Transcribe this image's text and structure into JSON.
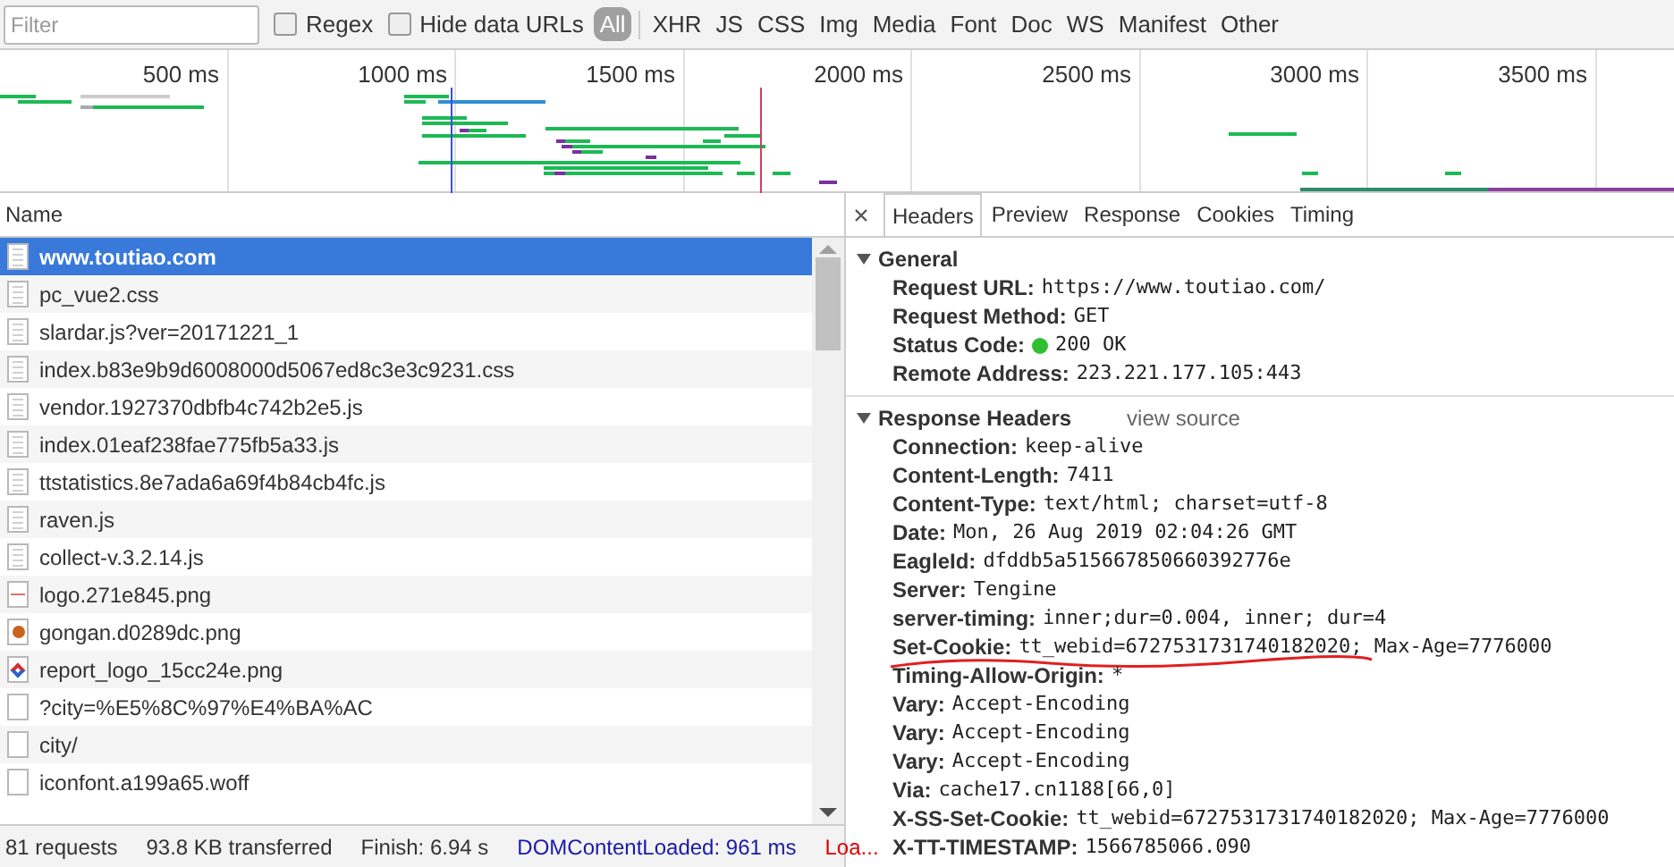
{
  "toolbar": {
    "filter": {
      "placeholder": "Filter"
    },
    "checkboxes": [
      {
        "label": "Regex",
        "checked": false
      },
      {
        "label": "Hide data URLs",
        "checked": false
      }
    ],
    "types": [
      {
        "label": "All",
        "selected": true
      },
      {
        "label": "XHR",
        "selected": false
      },
      {
        "label": "JS",
        "selected": false
      },
      {
        "label": "CSS",
        "selected": false
      },
      {
        "label": "Img",
        "selected": false
      },
      {
        "label": "Media",
        "selected": false
      },
      {
        "label": "Font",
        "selected": false
      },
      {
        "label": "Doc",
        "selected": false
      },
      {
        "label": "WS",
        "selected": false
      },
      {
        "label": "Manifest",
        "selected": false
      },
      {
        "label": "Other",
        "selected": false
      }
    ]
  },
  "overview": {
    "ticks": [
      "500 ms",
      "1000 ms",
      "1500 ms",
      "2000 ms",
      "2500 ms",
      "3000 ms",
      "3500 ms"
    ]
  },
  "requests": {
    "column": "Name",
    "rows": [
      {
        "name": "www.toutiao.com",
        "kind": "document",
        "selected": true
      },
      {
        "name": "pc_vue2.css",
        "kind": "document",
        "selected": false
      },
      {
        "name": "slardar.js?ver=20171221_1",
        "kind": "document",
        "selected": false
      },
      {
        "name": "index.b83e9b9d6008000d5067ed8c3e3c9231.css",
        "kind": "document",
        "selected": false
      },
      {
        "name": "vendor.1927370dbfb4c742b2e5.js",
        "kind": "document",
        "selected": false
      },
      {
        "name": "index.01eaf238fae775fb5a33.js",
        "kind": "document",
        "selected": false
      },
      {
        "name": "ttstatistics.8e7ada6a69f4b84cb4fc.js",
        "kind": "document",
        "selected": false
      },
      {
        "name": "raven.js",
        "kind": "document",
        "selected": false
      },
      {
        "name": "collect-v.3.2.14.js",
        "kind": "document",
        "selected": false
      },
      {
        "name": "logo.271e845.png",
        "kind": "line",
        "selected": false
      },
      {
        "name": "gongan.d0289dc.png",
        "kind": "dot",
        "selected": false
      },
      {
        "name": "report_logo_15cc24e.png",
        "kind": "diamond",
        "selected": false
      },
      {
        "name": "?city=%E5%8C%97%E4%BA%AC",
        "kind": "blank",
        "selected": false
      },
      {
        "name": "city/",
        "kind": "blank",
        "selected": false
      },
      {
        "name": "iconfont.a199a65.woff",
        "kind": "blank",
        "selected": false
      }
    ]
  },
  "status_bar": [
    {
      "text": "81 requests",
      "kind": "plain"
    },
    {
      "text": "93.8 KB transferred",
      "kind": "plain"
    },
    {
      "text": "Finish: 6.94 s",
      "kind": "plain"
    },
    {
      "text": "DOMContentLoaded: 961 ms",
      "kind": "blue"
    },
    {
      "text": "Loa...",
      "kind": "red"
    }
  ],
  "details": {
    "tabs": [
      {
        "label": "Headers",
        "selected": true
      },
      {
        "label": "Preview",
        "selected": false
      },
      {
        "label": "Response",
        "selected": false
      },
      {
        "label": "Cookies",
        "selected": false
      },
      {
        "label": "Timing",
        "selected": false
      }
    ],
    "sections": [
      {
        "title": "General",
        "expanded": true,
        "rows": [
          {
            "key": "Request URL:",
            "value": "https://www.toutiao.com/"
          },
          {
            "key": "Request Method:",
            "value": "GET"
          },
          {
            "key": "Status Code:",
            "value": "200 OK",
            "status_dot": true
          },
          {
            "key": "Remote Address:",
            "value": "223.221.177.105:443"
          }
        ]
      },
      {
        "title": "Response Headers",
        "link": "view source",
        "expanded": true,
        "rows": [
          {
            "key": "Connection:",
            "value": "keep-alive"
          },
          {
            "key": "Content-Length:",
            "value": "7411"
          },
          {
            "key": "Content-Type:",
            "value": "text/html; charset=utf-8"
          },
          {
            "key": "Date:",
            "value": "Mon, 26 Aug 2019 02:04:26 GMT"
          },
          {
            "key": "EagleId:",
            "value": "dfddb5a515667850660392776e"
          },
          {
            "key": "Server:",
            "value": "Tengine"
          },
          {
            "key": "server-timing:",
            "value": "inner;dur=0.004, inner; dur=4"
          },
          {
            "key": "Set-Cookie:",
            "value": "tt_webid=6727531731740182020; Max-Age=7776000",
            "underlined": true
          },
          {
            "key": "Timing-Allow-Origin:",
            "value": "*"
          },
          {
            "key": "Vary:",
            "value": "Accept-Encoding"
          },
          {
            "key": "Vary:",
            "value": "Accept-Encoding"
          },
          {
            "key": "Vary:",
            "value": "Accept-Encoding"
          },
          {
            "key": "Via:",
            "value": "cache17.cn1188[66,0]"
          },
          {
            "key": "X-SS-Set-Cookie:",
            "value": "tt_webid=6727531731740182020; Max-Age=7776000"
          },
          {
            "key": "X-TT-TIMESTAMP:",
            "value": "1566785066.090"
          }
        ]
      }
    ]
  }
}
